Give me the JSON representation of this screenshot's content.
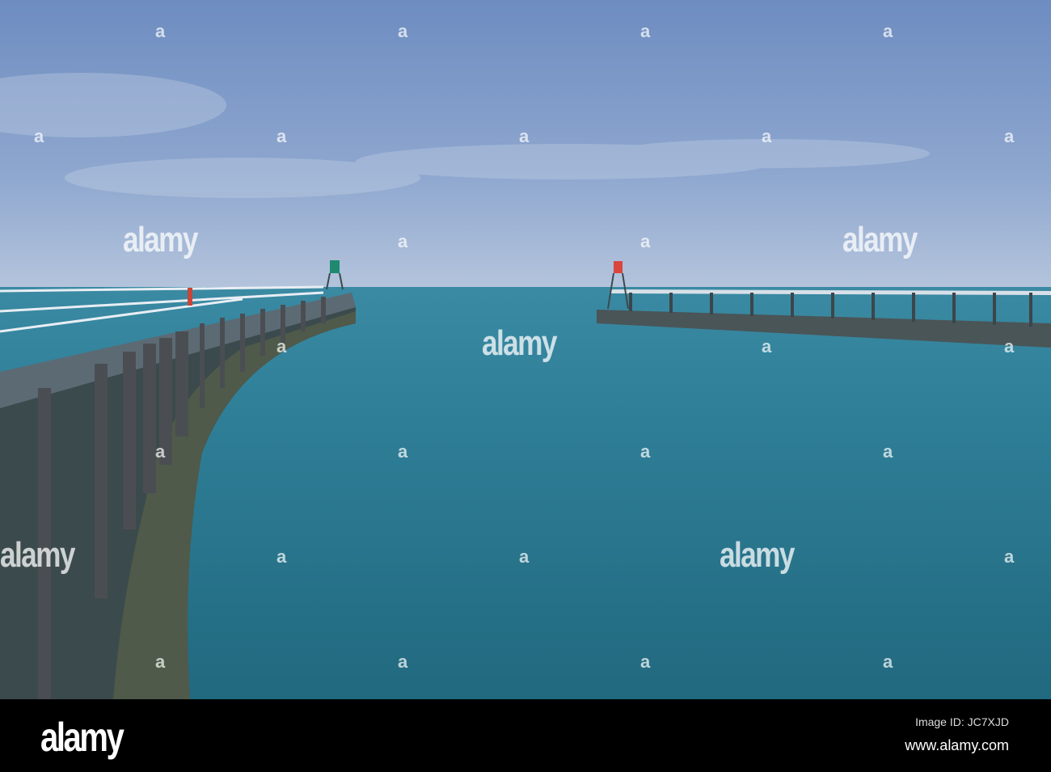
{
  "photo": {
    "description_label": "Harbour piers with lighthouses",
    "colors": {
      "sky_top": "#6d8cc0",
      "sky_horizon": "#b4c4dc",
      "sea_near": "#21697f",
      "sea_far": "#3a8aa3"
    }
  },
  "watermark": {
    "text": "alamy",
    "mark": "a"
  },
  "footer": {
    "logo": "alamy",
    "image_id": "Image ID: JC7XJD",
    "website": "www.alamy.com"
  }
}
